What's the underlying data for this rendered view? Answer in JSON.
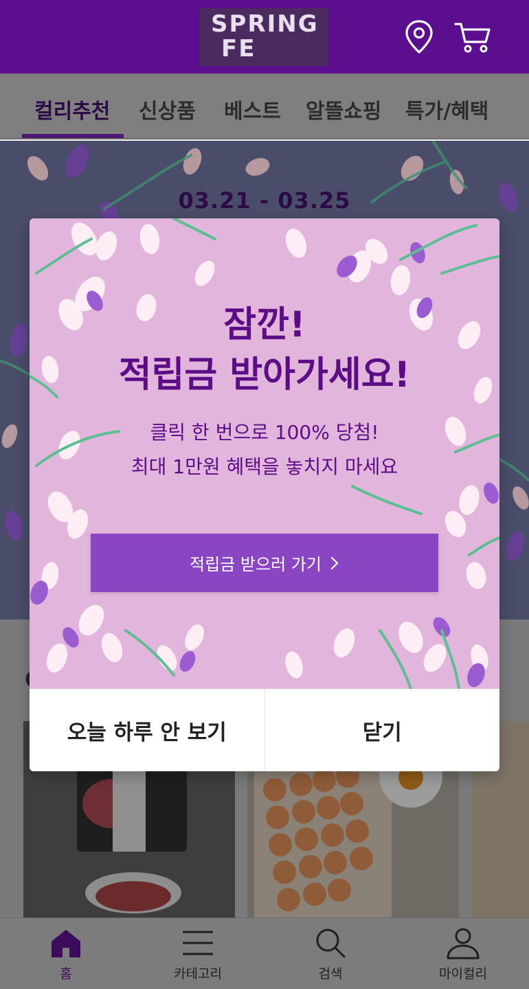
{
  "header": {
    "logo_line1": "SPRING",
    "logo_line2": "FE",
    "icons": [
      "location-pin-icon",
      "cart-icon"
    ],
    "colors": {
      "background": "#5b0f8f"
    }
  },
  "tabs": [
    {
      "label": "컬리추천",
      "active": true
    },
    {
      "label": "신상품",
      "active": false
    },
    {
      "label": "베스트",
      "active": false
    },
    {
      "label": "알뜰쇼핑",
      "active": false
    },
    {
      "label": "특가/혜택",
      "active": false
    }
  ],
  "banner": {
    "date_range": "03.21 - 03.25"
  },
  "section": {
    "title_partial": "C"
  },
  "modal": {
    "title_line1": "잠깐!",
    "title_line2": "적립금 받아가세요!",
    "subtitle_line1": "클릭 한 번으로 100% 당첨!",
    "subtitle_line2": "최대 1만원 혜택을 놓치지 마세요",
    "cta_label": "적립금 받으러 가기",
    "dismiss_today_label": "오늘 하루 안 보기",
    "close_label": "닫기",
    "colors": {
      "background": "#e2b6dc",
      "text": "#5c0d85",
      "cta": "#8a46c2"
    }
  },
  "bottom_nav": [
    {
      "label": "홈",
      "icon": "home-icon",
      "active": true
    },
    {
      "label": "카테고리",
      "icon": "menu-icon",
      "active": false
    },
    {
      "label": "검색",
      "icon": "search-icon",
      "active": false
    },
    {
      "label": "마이컬리",
      "icon": "user-icon",
      "active": false
    }
  ]
}
